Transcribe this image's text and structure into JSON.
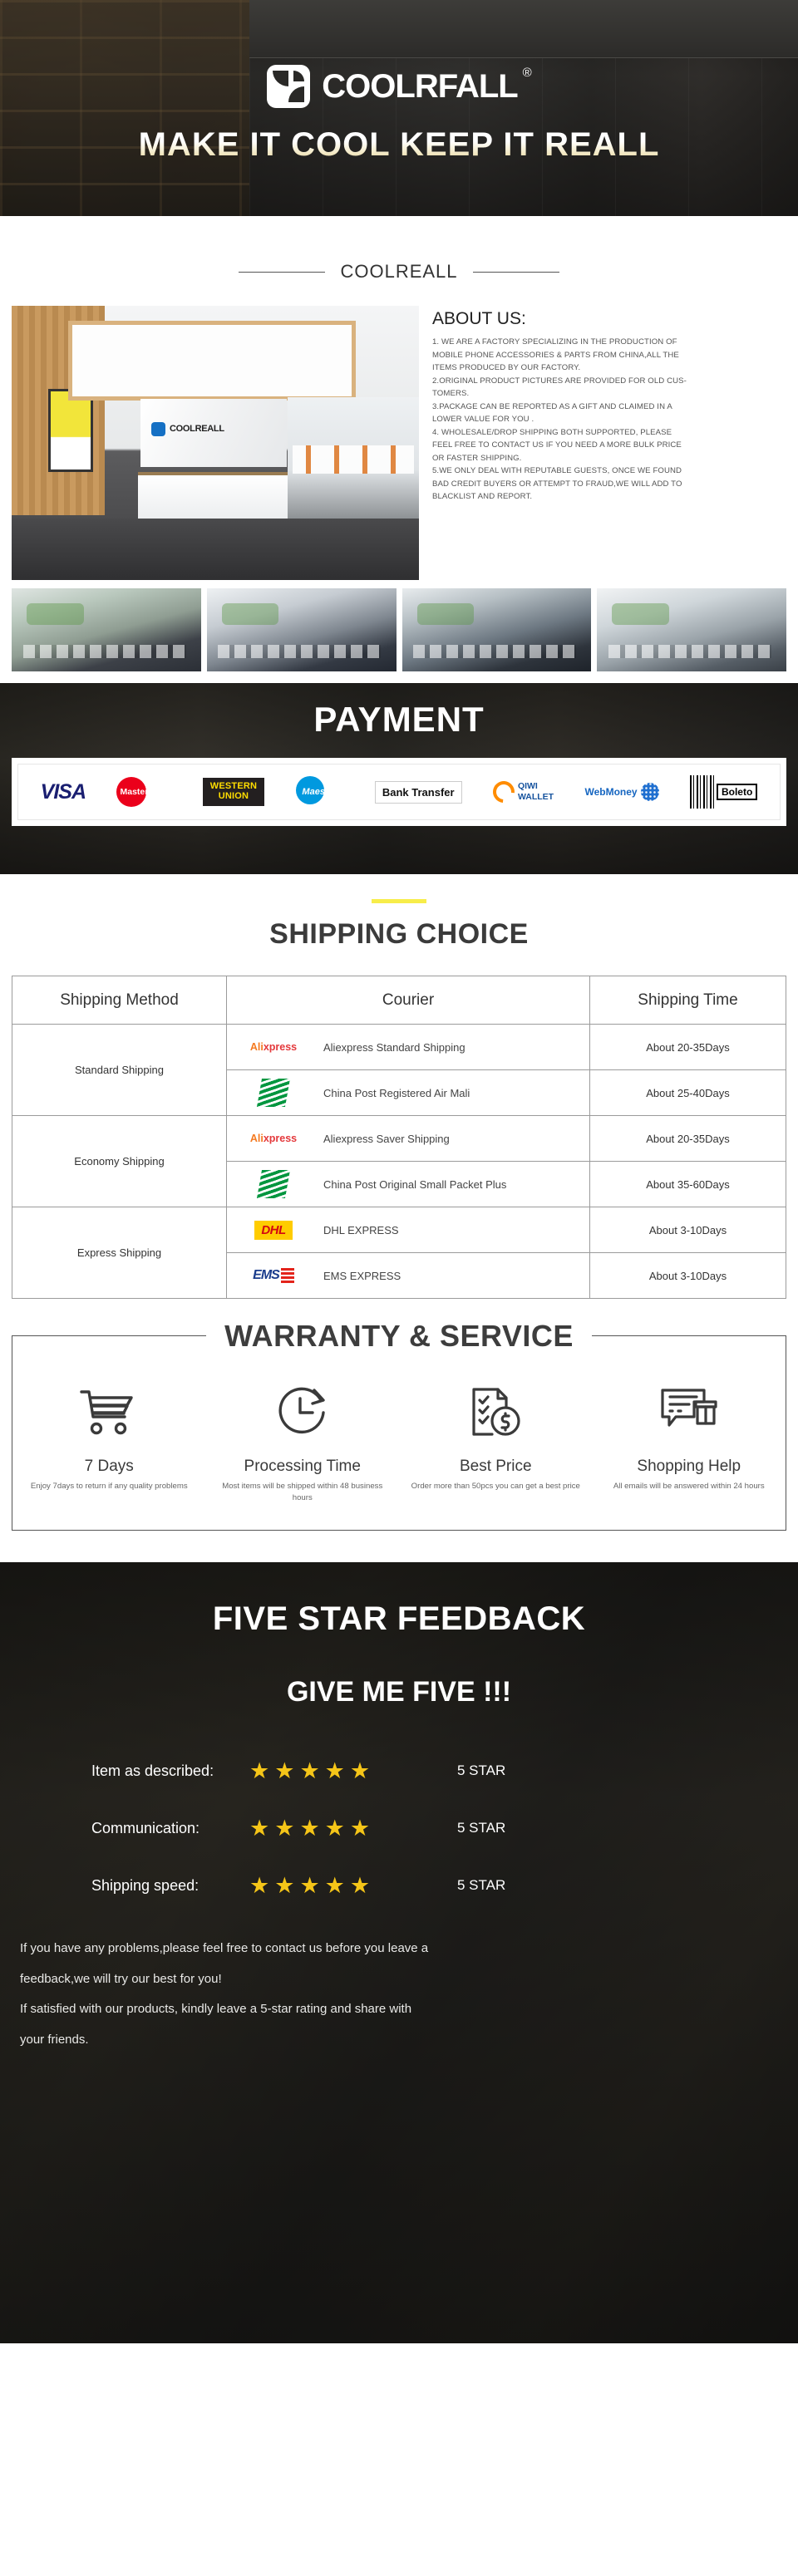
{
  "hero": {
    "logo_word": "COOLRFALL",
    "registered_mark": "®",
    "tagline": "MAKE IT COOL KEEP IT REALL"
  },
  "about": {
    "brand_divider": "COOLREALL",
    "title": "ABOUT US:",
    "photo_logo_text": "COOLREALL",
    "points": [
      "1. WE ARE A FACTORY SPECIALIZING IN THE PRODUCTION OF",
      "MOBILE PHONE ACCESSORIES & PARTS FROM CHINA,ALL THE",
      "ITEMS PRODUCED BY OUR FACTORY.",
      "2.ORIGINAL PRODUCT PICTURES ARE PROVIDED FOR OLD CUS-",
      "TOMERS.",
      "3.PACKAGE CAN BE REPORTED AS A GIFT AND CLAIMED IN A",
      "LOWER VALUE FOR YOU .",
      "4. WHOLESALE/DROP SHIPPING BOTH SUPPORTED, PLEASE",
      "FEEL FREE TO CONTACT US IF YOU NEED A MORE BULK PRICE",
      "OR FASTER SHIPPING.",
      "5.WE ONLY DEAL WITH REPUTABLE GUESTS, ONCE WE FOUND",
      "BAD CREDIT BUYERS OR ATTEMPT TO FRAUD,WE WILL ADD TO",
      "BLACKLIST AND REPORT."
    ]
  },
  "payment": {
    "title": "PAYMENT",
    "methods": [
      {
        "name": "visa-logo",
        "label": "VISA"
      },
      {
        "name": "mastercard-logo",
        "label": "MasterCard"
      },
      {
        "name": "western-union-logo",
        "line1": "WESTERN",
        "line2": "UNION"
      },
      {
        "name": "maestro-logo",
        "label": "Maestro"
      },
      {
        "name": "bank-transfer-logo",
        "label": "Bank Transfer"
      },
      {
        "name": "qiwi-wallet-logo",
        "line1": "QIWI",
        "line2": "WALLET"
      },
      {
        "name": "webmoney-logo",
        "label": "WebMoney"
      },
      {
        "name": "boleto-logo",
        "label": "Boleto"
      }
    ]
  },
  "shipping": {
    "title": "SHIPPING CHOICE",
    "headers": {
      "method": "Shipping Method",
      "courier": "Courier",
      "time": "Shipping Time"
    },
    "groups": [
      {
        "method": "Standard Shipping",
        "rows": [
          {
            "logo": "aliexpress-logo",
            "courier": "Aliexpress Standard Shipping",
            "time": "About 20-35Days"
          },
          {
            "logo": "china-post-logo",
            "courier": "China Post Registered Air Mali",
            "time": "About 25-40Days"
          }
        ]
      },
      {
        "method": "Economy Shipping",
        "rows": [
          {
            "logo": "aliexpress-logo",
            "courier": "Aliexpress Saver Shipping",
            "time": "About 20-35Days"
          },
          {
            "logo": "china-post-logo",
            "courier": "China Post Original Small Packet Plus",
            "time": "About 35-60Days"
          }
        ]
      },
      {
        "method": "Express Shipping",
        "rows": [
          {
            "logo": "dhl-logo",
            "courier": "DHL EXPRESS",
            "time": "About 3-10Days"
          },
          {
            "logo": "ems-logo",
            "courier": "EMS EXPRESS",
            "time": "About 3-10Days"
          }
        ]
      }
    ],
    "logo_labels": {
      "aliexpress": "Ali",
      "aliexpress_suffix": "xpress",
      "dhl": "DHL",
      "ems": "EMS"
    }
  },
  "warranty": {
    "title": "WARRANTY & SERVICE",
    "highlight_color": "#f9f318",
    "items": [
      {
        "icon": "shopping-cart-icon",
        "heading": "7 Days",
        "desc": "Enjoy 7days to return if any quality problems"
      },
      {
        "icon": "clock-icon",
        "heading": "Processing Time",
        "desc": "Most items will be shipped within 48 business hours"
      },
      {
        "icon": "checklist-dollar-icon",
        "heading": "Best Price",
        "desc": "Order more than 50pcs you can get a best price"
      },
      {
        "icon": "chat-store-icon",
        "heading": "Shopping Help",
        "desc": "All emails will be answered within 24 hours"
      }
    ]
  },
  "feedback": {
    "heading": "FIVE STAR FEEDBACK",
    "subheading": "GIVE ME FIVE !!!",
    "star_color": "#f5c518",
    "star_glyph": "★",
    "rows": [
      {
        "label": "Item as described:",
        "stars": 5,
        "value": "5 STAR"
      },
      {
        "label": "Communication:",
        "stars": 5,
        "value": "5 STAR"
      },
      {
        "label": "Shipping speed:",
        "stars": 5,
        "value": "5 STAR"
      }
    ],
    "notes": [
      "If you have any problems,please feel free to contact us before you leave a",
      "feedback,we will try our best for you!",
      "If satisfied with our products, kindly leave a 5-star rating and share with",
      "your friends."
    ]
  }
}
